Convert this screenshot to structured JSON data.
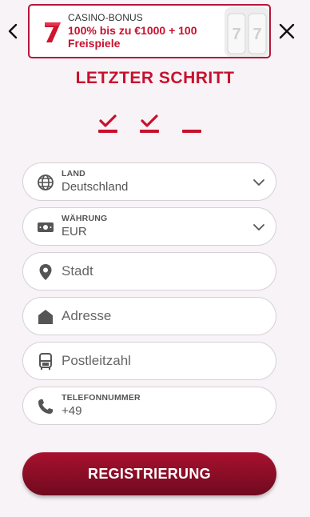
{
  "header": {
    "back_icon": "chevron-left-icon",
    "close_icon": "close-icon"
  },
  "bonus": {
    "label": "CASINO-BONUS",
    "offer": "100% bis zu €1000 + 100 Freispiele",
    "icon": "lucky-seven-icon"
  },
  "title": "LETZTER SCHRITT",
  "steps": [
    {
      "state": "done",
      "icon": "checkmark-icon"
    },
    {
      "state": "done",
      "icon": "checkmark-icon"
    },
    {
      "state": "current",
      "icon": ""
    }
  ],
  "form": {
    "country": {
      "label": "LAND",
      "value": "Deutschland",
      "icon": "globe-icon"
    },
    "currency": {
      "label": "WÄHRUNG",
      "value": "EUR",
      "icon": "money-icon"
    },
    "city": {
      "placeholder": "Stadt",
      "icon": "location-pin-icon"
    },
    "address": {
      "placeholder": "Adresse",
      "icon": "home-icon"
    },
    "postcode": {
      "placeholder": "Postleitzahl",
      "icon": "mailbox-icon"
    },
    "phone": {
      "label": "TELEFONNUMMER",
      "value": "+49",
      "icon": "phone-icon"
    }
  },
  "submit_label": "REGISTRIERUNG",
  "colors": {
    "accent": "#c8102e",
    "button_top": "#a8112f",
    "button_bottom": "#6f0a1e",
    "background": "#f7f3f6"
  }
}
